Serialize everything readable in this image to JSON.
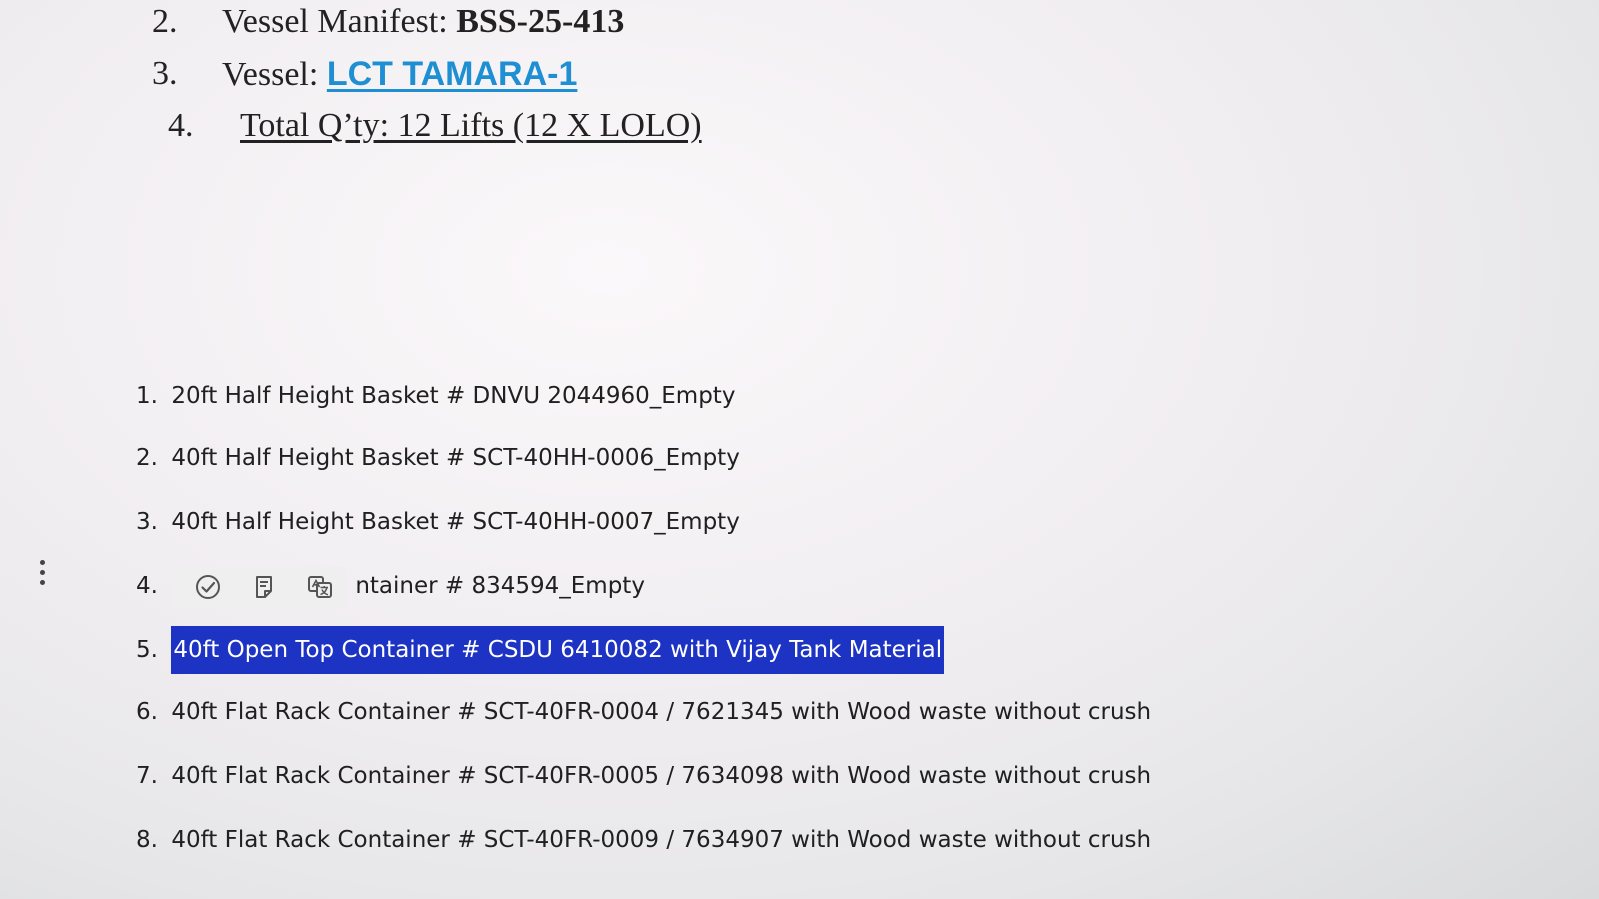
{
  "header": {
    "line2": {
      "num": "2.",
      "label": "Vessel Manifest: ",
      "value": "BSS-25-413"
    },
    "line3": {
      "num": "3.",
      "label": "Vessel: ",
      "value": "LCT TAMARA-1"
    },
    "line4": {
      "num": "4.",
      "text": "Total Q’ty: 12 Lifts (12 X LOLO)"
    }
  },
  "items": [
    {
      "num": "1.",
      "text": "20ft Half Height Basket # DNVU 2044960_Empty"
    },
    {
      "num": "2.",
      "text": "40ft Half Height Basket # SCT-40HH-0006_Empty"
    },
    {
      "num": "3.",
      "text": "40ft Half Height Basket # SCT-40HH-0007_Empty"
    },
    {
      "num": "4.",
      "text": "ntainer # 834594_Empty"
    },
    {
      "num": "5.",
      "text": "40ft Open Top Container # CSDU 6410082 with Vijay Tank Material"
    },
    {
      "num": "6.",
      "text": "40ft Flat Rack Container # SCT-40FR-0004 / 7621345 with Wood waste without crush"
    },
    {
      "num": "7.",
      "text": "40ft Flat Rack Container # SCT-40FR-0005 / 7634098 with Wood waste without crush"
    },
    {
      "num": "8.",
      "text": "40ft Flat Rack Container # SCT-40FR-0009 / 7634907 with Wood waste without crush"
    }
  ],
  "toolbar": {
    "icons": [
      "check-circle-icon",
      "note-icon",
      "translate-icon"
    ]
  },
  "colors": {
    "selection": "#1d33c4",
    "link": "#1f8fd3"
  }
}
